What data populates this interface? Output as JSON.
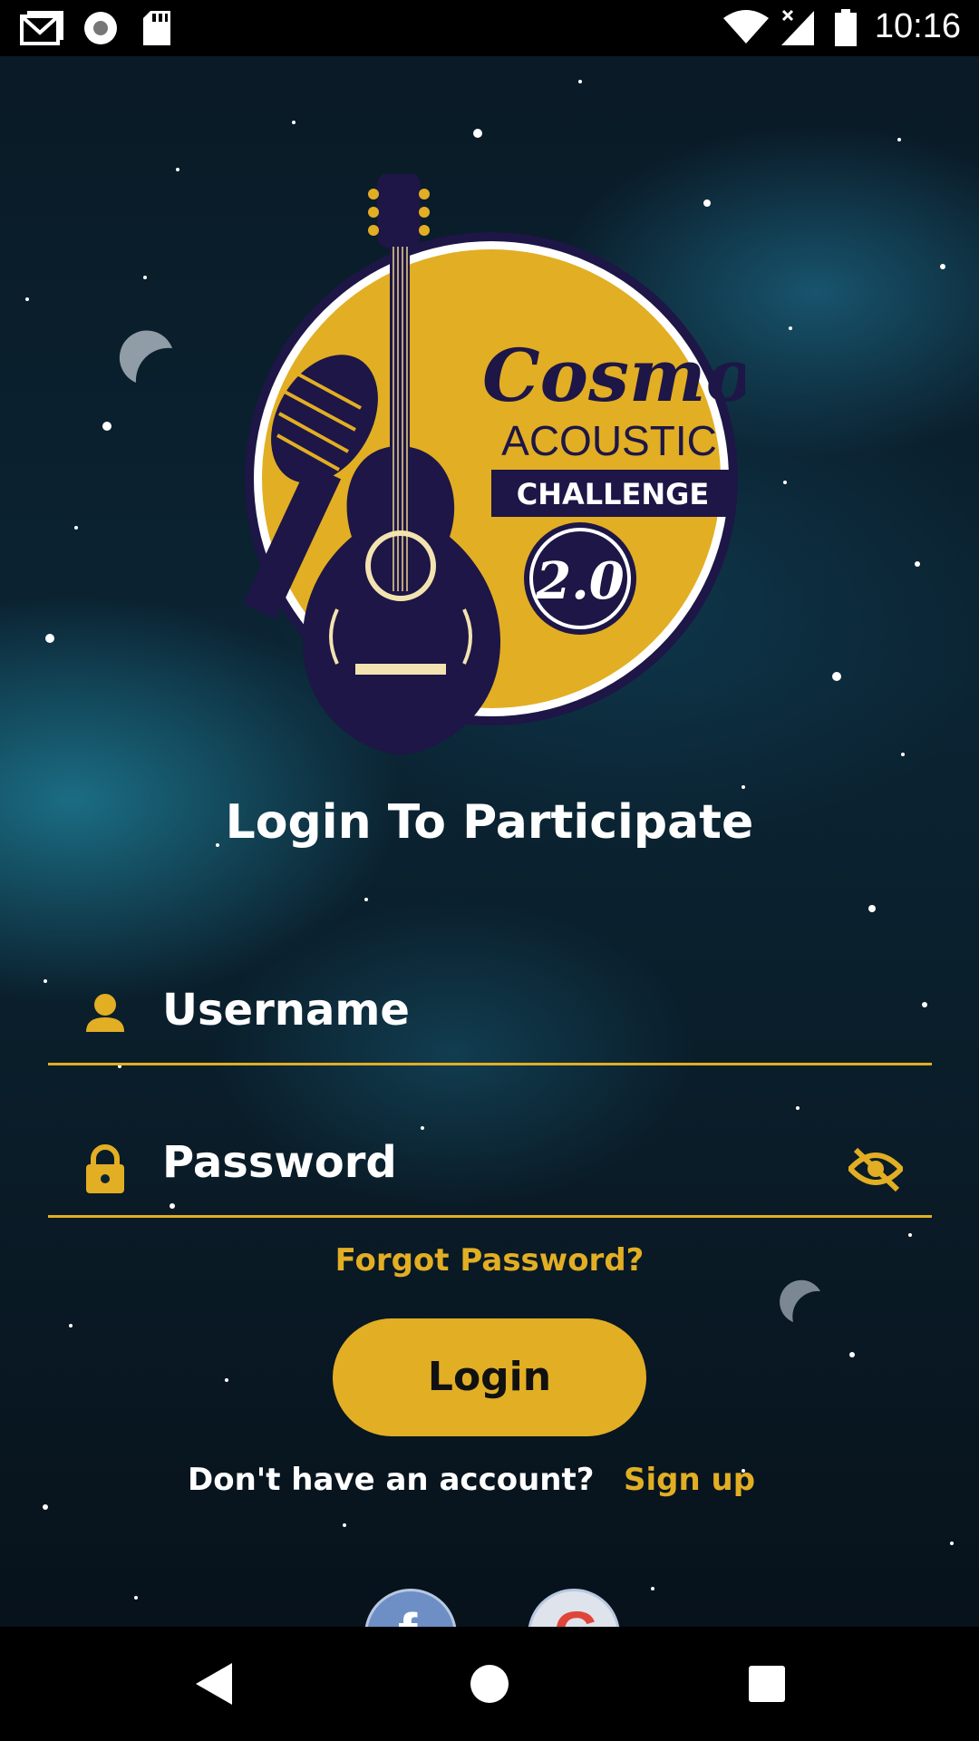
{
  "status_bar": {
    "time": "10:16",
    "icons": [
      "gmail-icon",
      "record-icon",
      "sd-card-icon",
      "wifi-icon",
      "signal-no-data-icon",
      "battery-icon"
    ]
  },
  "logo": {
    "word1": "Cosmo",
    "word2": "ACOUSTIC",
    "word3": "CHALLENGE",
    "badge": "2.0",
    "colors": {
      "yellow": "#e2ae24",
      "navy": "#1d1646"
    }
  },
  "login": {
    "title": "Login To Participate",
    "username_placeholder": "Username",
    "password_placeholder": "Password",
    "forgot_label": "Forgot Password?",
    "login_label": "Login",
    "no_account_text": "Don't have an account?",
    "signup_label": "Sign up"
  },
  "theme": {
    "accent": "#e2ae24",
    "text": "#ffffff"
  },
  "social": [
    "facebook-icon",
    "google-icon"
  ],
  "nav_bar": [
    "back-icon",
    "home-icon",
    "recents-icon"
  ]
}
